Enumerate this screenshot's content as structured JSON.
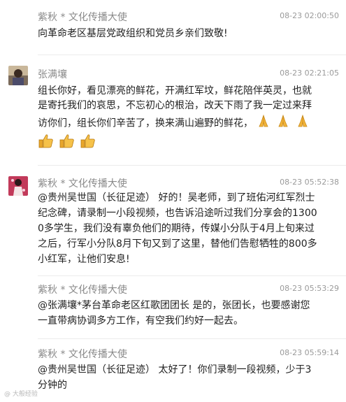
{
  "comments": [
    {
      "author": "紫秋 * 文化传播大使",
      "time": "08-23 02:00:50",
      "text": "向革命老区基层党政组织和党员乡亲们致敬!"
    },
    {
      "author": "张满壤",
      "time": "08-23 02:21:05",
      "lines": [
        "组长你好，看见漂亮的鲜花，开满红军坟，鲜花陪伴英灵，也就",
        "是寄托我们的哀思，不忘初心的根治，改天下雨了我一定过来拜",
        "访你们，组长你们辛苦了，换来满山遍野的鲜花，"
      ],
      "emojis_inline": [
        "praying-hands",
        "praying-hands",
        "praying-hands"
      ],
      "emojis_row": [
        "thumbs-up",
        "thumbs-up",
        "thumbs-up"
      ]
    },
    {
      "author": "紫秋 * 文化传播大使",
      "time": "08-23 05:52:38",
      "lines": [
        "@贵州吴世国（长征足迹） 好的！吴老师，到了班佑河红军烈士",
        "纪念碑，请录制一小段视频，也告诉沿途听过我们分享会的1300",
        "0多学生，我们没有辜负他们的期待，传媒小分队于4月上旬来过",
        "之后，行军小分队8月下旬又到了这里，替他们告慰牺牲的800多",
        "小红军，让他们安息!"
      ]
    },
    {
      "author": "紫秋 * 文化传播大使",
      "time": "08-23 05:53:29",
      "lines": [
        "@张满壤*茅台革命老区红歌团团长 是的，张团长，也要感谢您",
        "一直带病协调多方工作，有空我们约好一起去。"
      ]
    },
    {
      "author": "紫秋 * 文化传播大使",
      "time": "08-23 05:59:14",
      "lines": [
        "@贵州吴世国（长征足迹） 太好了！你们录制一段视频，少于3",
        "分钟的"
      ]
    }
  ],
  "watermark": "@ 大般经验",
  "colors": {
    "text": "#1f1f1f",
    "meta": "#8a8a8a",
    "divider": "#ececec"
  }
}
